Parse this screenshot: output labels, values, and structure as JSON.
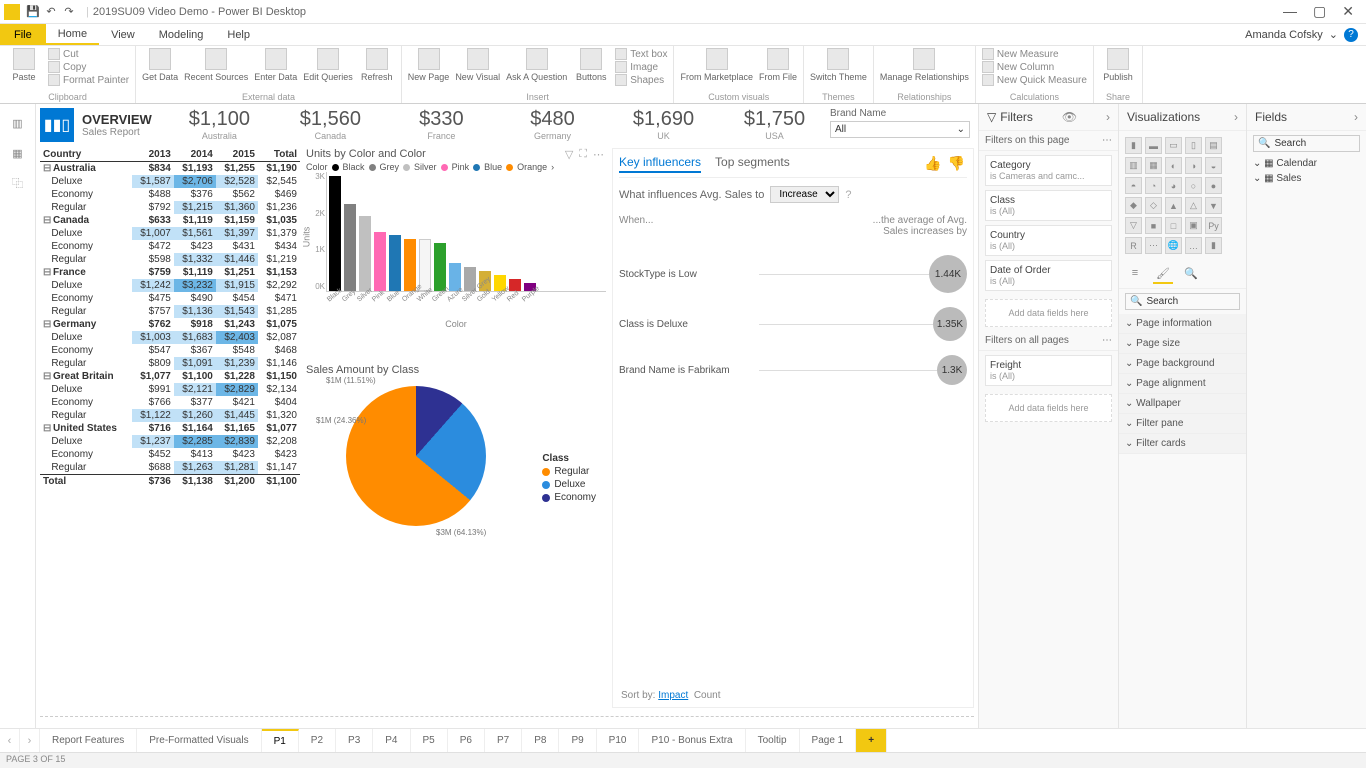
{
  "app": {
    "title": "2019SU09 Video Demo - Power BI Desktop",
    "user": "Amanda Cofsky"
  },
  "menu": {
    "file": "File",
    "tabs": [
      "Home",
      "View",
      "Modeling",
      "Help"
    ],
    "active": "Home"
  },
  "ribbon": {
    "clipboard": {
      "paste": "Paste",
      "cut": "Cut",
      "copy": "Copy",
      "format_painter": "Format Painter",
      "label": "Clipboard"
    },
    "externaldata": {
      "get_data": "Get\nData",
      "recent": "Recent\nSources",
      "enter": "Enter\nData",
      "edit": "Edit\nQueries",
      "refresh": "Refresh",
      "label": "External data"
    },
    "insert": {
      "new_page": "New\nPage",
      "new_visual": "New\nVisual",
      "ask": "Ask A\nQuestion",
      "buttons": "Buttons",
      "textbox": "Text box",
      "image": "Image",
      "shapes": "Shapes",
      "label": "Insert"
    },
    "custom": {
      "marketplace": "From\nMarketplace",
      "file": "From\nFile",
      "label": "Custom visuals"
    },
    "themes": {
      "switch": "Switch\nTheme",
      "label": "Themes"
    },
    "relationships": {
      "manage": "Manage\nRelationships",
      "label": "Relationships"
    },
    "calculations": {
      "new_measure": "New Measure",
      "new_column": "New Column",
      "new_quick": "New Quick Measure",
      "label": "Calculations"
    },
    "share": {
      "publish": "Publish",
      "label": "Share"
    }
  },
  "overview": {
    "title": "OVERVIEW",
    "subtitle": "Sales Report"
  },
  "kpis": [
    {
      "value": "$1,100",
      "label": "Australia"
    },
    {
      "value": "$1,560",
      "label": "Canada"
    },
    {
      "value": "$330",
      "label": "France"
    },
    {
      "value": "$480",
      "label": "Germany"
    },
    {
      "value": "$1,690",
      "label": "UK"
    },
    {
      "value": "$1,750",
      "label": "USA"
    }
  ],
  "brand_slicer": {
    "label": "Brand Name",
    "value": "All"
  },
  "matrix": {
    "headers": [
      "Country",
      "2013",
      "2014",
      "2015",
      "Total"
    ],
    "rows": [
      {
        "type": "country",
        "label": "Australia",
        "v": [
          "$834",
          "$1,193",
          "$1,255",
          "$1,190"
        ]
      },
      {
        "type": "sub",
        "label": "Deluxe",
        "v": [
          "$1,587",
          "$2,706",
          "$2,528",
          "$2,545"
        ],
        "hl": [
          1,
          2,
          1
        ]
      },
      {
        "type": "sub",
        "label": "Economy",
        "v": [
          "$488",
          "$376",
          "$562",
          "$469"
        ]
      },
      {
        "type": "sub",
        "label": "Regular",
        "v": [
          "$792",
          "$1,215",
          "$1,360",
          "$1,236"
        ],
        "hl": [
          0,
          1,
          1
        ]
      },
      {
        "type": "country",
        "label": "Canada",
        "v": [
          "$633",
          "$1,119",
          "$1,159",
          "$1,035"
        ]
      },
      {
        "type": "sub",
        "label": "Deluxe",
        "v": [
          "$1,007",
          "$1,561",
          "$1,397",
          "$1,379"
        ],
        "hl": [
          1,
          1,
          1
        ]
      },
      {
        "type": "sub",
        "label": "Economy",
        "v": [
          "$472",
          "$423",
          "$431",
          "$434"
        ]
      },
      {
        "type": "sub",
        "label": "Regular",
        "v": [
          "$598",
          "$1,332",
          "$1,446",
          "$1,219"
        ],
        "hl": [
          0,
          1,
          1
        ]
      },
      {
        "type": "country",
        "label": "France",
        "v": [
          "$759",
          "$1,119",
          "$1,251",
          "$1,153"
        ]
      },
      {
        "type": "sub",
        "label": "Deluxe",
        "v": [
          "$1,242",
          "$3,232",
          "$1,915",
          "$2,292"
        ],
        "hl": [
          1,
          2,
          1
        ]
      },
      {
        "type": "sub",
        "label": "Economy",
        "v": [
          "$475",
          "$490",
          "$454",
          "$471"
        ]
      },
      {
        "type": "sub",
        "label": "Regular",
        "v": [
          "$757",
          "$1,136",
          "$1,543",
          "$1,285"
        ],
        "hl": [
          0,
          1,
          1
        ]
      },
      {
        "type": "country",
        "label": "Germany",
        "v": [
          "$762",
          "$918",
          "$1,243",
          "$1,075"
        ]
      },
      {
        "type": "sub",
        "label": "Deluxe",
        "v": [
          "$1,003",
          "$1,683",
          "$2,403",
          "$2,087"
        ],
        "hl": [
          1,
          1,
          2
        ]
      },
      {
        "type": "sub",
        "label": "Economy",
        "v": [
          "$547",
          "$367",
          "$548",
          "$468"
        ]
      },
      {
        "type": "sub",
        "label": "Regular",
        "v": [
          "$809",
          "$1,091",
          "$1,239",
          "$1,146"
        ],
        "hl": [
          0,
          1,
          1
        ]
      },
      {
        "type": "country",
        "label": "Great Britain",
        "v": [
          "$1,077",
          "$1,100",
          "$1,228",
          "$1,150"
        ]
      },
      {
        "type": "sub",
        "label": "Deluxe",
        "v": [
          "$991",
          "$2,121",
          "$2,829",
          "$2,134"
        ],
        "hl": [
          0,
          1,
          2
        ]
      },
      {
        "type": "sub",
        "label": "Economy",
        "v": [
          "$766",
          "$377",
          "$421",
          "$404"
        ]
      },
      {
        "type": "sub",
        "label": "Regular",
        "v": [
          "$1,122",
          "$1,260",
          "$1,445",
          "$1,320"
        ],
        "hl": [
          1,
          1,
          1
        ]
      },
      {
        "type": "country",
        "label": "United States",
        "v": [
          "$716",
          "$1,164",
          "$1,165",
          "$1,077"
        ]
      },
      {
        "type": "sub",
        "label": "Deluxe",
        "v": [
          "$1,237",
          "$2,285",
          "$2,839",
          "$2,208"
        ],
        "hl": [
          1,
          2,
          2
        ]
      },
      {
        "type": "sub",
        "label": "Economy",
        "v": [
          "$452",
          "$413",
          "$423",
          "$423"
        ]
      },
      {
        "type": "sub",
        "label": "Regular",
        "v": [
          "$688",
          "$1,263",
          "$1,281",
          "$1,147"
        ],
        "hl": [
          0,
          1,
          1
        ]
      }
    ],
    "total": {
      "label": "Total",
      "v": [
        "$736",
        "$1,138",
        "$1,200",
        "$1,100"
      ]
    }
  },
  "chart_data": [
    {
      "id": "units_by_color",
      "type": "bar",
      "title": "Units by Color and Color",
      "legend_title": "Color",
      "xlabel": "Color",
      "ylabel": "Units",
      "ylim": [
        0,
        3000
      ],
      "yticks": [
        "0K",
        "1K",
        "2K",
        "3K"
      ],
      "categories": [
        "Black",
        "Grey",
        "Silver",
        "Pink",
        "Blue",
        "Orange",
        "White",
        "Green",
        "Azure",
        "Silver Grey",
        "Gold",
        "Yellow",
        "Red",
        "Purple"
      ],
      "values": [
        2900,
        2200,
        1900,
        1500,
        1400,
        1300,
        1300,
        1200,
        700,
        600,
        500,
        400,
        300,
        200
      ],
      "colors": [
        "#000000",
        "#808080",
        "#c0c0c0",
        "#ff69b4",
        "#1f77b4",
        "#ff8c00",
        "#f5f5f5",
        "#2ca02c",
        "#69b3e7",
        "#a9a9a9",
        "#d4af37",
        "#ffd700",
        "#d62728",
        "#800080"
      ]
    },
    {
      "id": "sales_by_class",
      "type": "pie",
      "title": "Sales Amount by Class",
      "legend_title": "Class",
      "series": [
        {
          "name": "Regular",
          "value_label": "$3M (64.13%)",
          "pct": 64.13,
          "color": "#ff8c00"
        },
        {
          "name": "Deluxe",
          "value_label": "$1M (24.36%)",
          "pct": 24.36,
          "color": "#2b8cde"
        },
        {
          "name": "Economy",
          "value_label": "$1M (11.51%)",
          "pct": 11.51,
          "color": "#2e3192"
        }
      ]
    }
  ],
  "ki": {
    "tabs": [
      "Key influencers",
      "Top segments"
    ],
    "question_prefix": "What influences Avg. Sales to",
    "dropdown": "Increase",
    "head_left": "When...",
    "head_right": "...the average of Avg. Sales increases by",
    "rows": [
      {
        "text": "StockType is Low",
        "value": "1.44K",
        "size": 38
      },
      {
        "text": "Class is Deluxe",
        "value": "1.35K",
        "size": 34
      },
      {
        "text": "Brand Name is Fabrikam",
        "value": "1.3K",
        "size": 30
      }
    ],
    "sort_label": "Sort by:",
    "sort_options": [
      "Impact",
      "Count"
    ],
    "sort_active": "Impact"
  },
  "filters": {
    "title": "Filters",
    "on_page": "Filters on this page",
    "on_all": "Filters on all pages",
    "page_filters": [
      {
        "name": "Category",
        "value": "is Cameras and camc..."
      },
      {
        "name": "Class",
        "value": "is (All)"
      },
      {
        "name": "Country",
        "value": "is (All)"
      },
      {
        "name": "Date of Order",
        "value": "is (All)"
      }
    ],
    "all_filters": [
      {
        "name": "Freight",
        "value": "is (All)"
      }
    ],
    "add": "Add data fields here"
  },
  "viz": {
    "title": "Visualizations",
    "search": "Search",
    "format_sections": [
      "Page information",
      "Page size",
      "Page background",
      "Page alignment",
      "Wallpaper",
      "Filter pane",
      "Filter cards"
    ]
  },
  "fields": {
    "title": "Fields",
    "search": "Search",
    "tables": [
      "Calendar",
      "Sales"
    ]
  },
  "pages": {
    "tabs": [
      "Report Features",
      "Pre-Formatted Visuals",
      "P1",
      "P2",
      "P3",
      "P4",
      "P5",
      "P6",
      "P7",
      "P8",
      "P9",
      "P10",
      "P10 - Bonus Extra",
      "Tooltip",
      "Page 1"
    ],
    "active": "P1"
  },
  "status": "PAGE 3 OF 15"
}
